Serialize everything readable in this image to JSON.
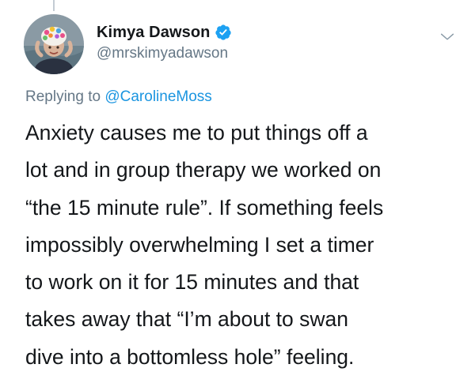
{
  "tweet": {
    "author": {
      "display_name": "Kimya Dawson",
      "handle": "@mrskimyadawson",
      "verified": true,
      "avatar_icon": "profile-photo-swim-cap"
    },
    "menu_icon": "chevron-down-icon",
    "reply": {
      "prefix": "Replying to ",
      "handle": "@CarolineMoss"
    },
    "text_lines": [
      "Anxiety causes me to put things off a",
      "lot and in group therapy we worked on",
      "“the 15 minute rule”. If something feels",
      "impossibly overwhelming I set a timer",
      "to work on it for 15 minutes and that",
      "takes away that “I’m about to swan",
      "dive into a bottomless hole” feeling."
    ]
  },
  "colors": {
    "text": "#14171a",
    "secondary": "#657786",
    "link": "#1b95e0",
    "verified_badge": "#1da1f2",
    "thread_line": "#c4ccd4"
  }
}
